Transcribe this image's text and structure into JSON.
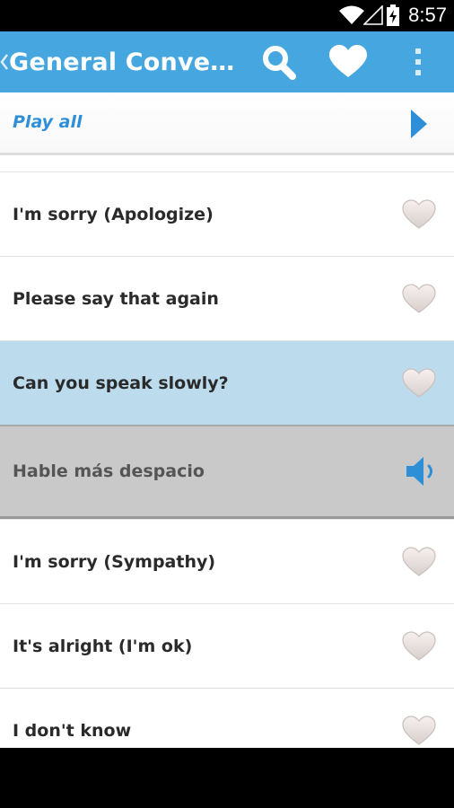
{
  "status_bar": {
    "time": "8:57",
    "icons": [
      "wifi-icon",
      "signal-icon",
      "battery-charging-icon"
    ]
  },
  "action_bar": {
    "title": "General Conve…",
    "icons": [
      "back-chevron-icon",
      "search-icon",
      "heart-icon",
      "overflow-menu-icon"
    ],
    "accent_color": "#45a6e0"
  },
  "play_all": {
    "label": "Play all",
    "icon": "play-icon",
    "color": "#2e8fd8"
  },
  "phrases": [
    {
      "text": "I'm sorry (Apologize)",
      "icon": "heart-outline-icon",
      "state": "normal"
    },
    {
      "text": "Please say that again",
      "icon": "heart-outline-icon",
      "state": "normal"
    },
    {
      "text": "Can you speak slowly?",
      "icon": "heart-outline-icon",
      "state": "selected"
    },
    {
      "text": "Hable más despacio",
      "icon": "speaker-icon",
      "state": "translation"
    },
    {
      "text": "I'm sorry (Sympathy)",
      "icon": "heart-outline-icon",
      "state": "normal"
    },
    {
      "text": "It's alright (I'm ok)",
      "icon": "heart-outline-icon",
      "state": "normal"
    },
    {
      "text": "I don't know",
      "icon": "heart-outline-icon",
      "state": "normal"
    }
  ],
  "colors": {
    "selected_row": "#bcdcee",
    "translation_row": "#c9c9c9"
  }
}
